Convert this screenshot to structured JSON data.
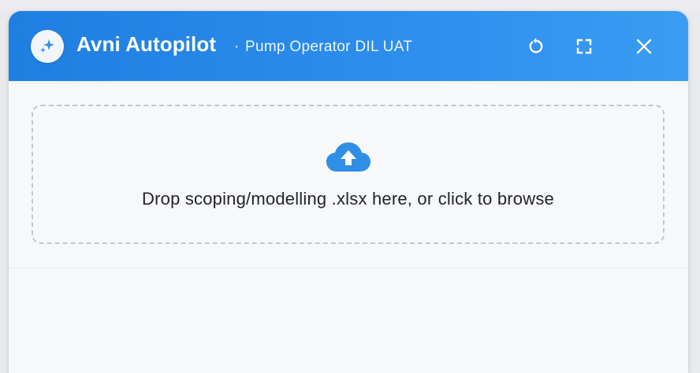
{
  "header": {
    "title": "Avni Autopilot",
    "separator": "·",
    "subtitle": "Pump Operator DIL UAT",
    "logo_icon": "sparkle-icon",
    "actions": [
      {
        "name": "refresh",
        "icon": "refresh-icon"
      },
      {
        "name": "fullscreen",
        "icon": "fullscreen-icon"
      },
      {
        "name": "close",
        "icon": "close-icon"
      }
    ]
  },
  "dropzone": {
    "icon": "cloud-upload-icon",
    "text": "Drop scoping/modelling .xlsx here, or click to browse"
  },
  "colors": {
    "header_start": "#1f7fe0",
    "header_end": "#3a9cf2",
    "accent": "#2f8fe6",
    "panel_bg": "#f7f8fa"
  }
}
